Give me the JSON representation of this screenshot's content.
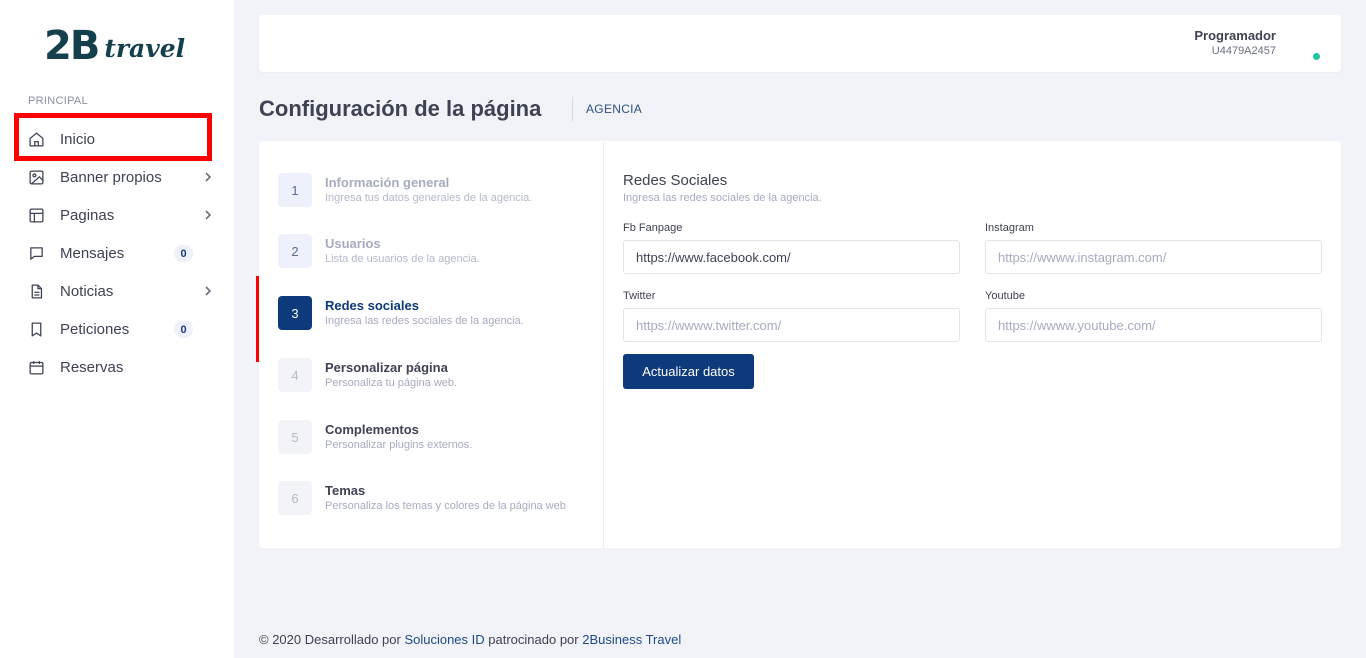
{
  "logo": {
    "main": "2B",
    "sub": "travel"
  },
  "sidebar": {
    "section_label": "PRINCIPAL",
    "items": [
      {
        "label": "Inicio",
        "icon": "home-icon"
      },
      {
        "label": "Banner propios",
        "icon": "image-icon",
        "chevron": true
      },
      {
        "label": "Paginas",
        "icon": "layout-icon",
        "chevron": true
      },
      {
        "label": "Mensajes",
        "icon": "message-icon",
        "badge": "0"
      },
      {
        "label": "Noticias",
        "icon": "document-icon",
        "chevron": true
      },
      {
        "label": "Peticiones",
        "icon": "bookmark-icon",
        "badge": "0"
      },
      {
        "label": "Reservas",
        "icon": "calendar-icon"
      }
    ]
  },
  "topbar": {
    "user_name": "Programador",
    "user_code": "U4479A2457",
    "status_color": "#1bc5a0"
  },
  "page": {
    "title": "Configuración de la página",
    "breadcrumb": "AGENCIA"
  },
  "steps": [
    {
      "number": "1",
      "title": "Información general",
      "desc": "Ingresa tus datos generales de la agencia.",
      "state": "done"
    },
    {
      "number": "2",
      "title": "Usuarios",
      "desc": "Lista de usuarios de la agencia.",
      "state": "done"
    },
    {
      "number": "3",
      "title": "Redes sociales",
      "desc": "Ingresa las redes sociales de la agencia.",
      "state": "active"
    },
    {
      "number": "4",
      "title": "Personalizar página",
      "desc": "Personaliza tu página web.",
      "state": "todo"
    },
    {
      "number": "5",
      "title": "Complementos",
      "desc": "Personalizar plugins externos.",
      "state": "todo"
    },
    {
      "number": "6",
      "title": "Temas",
      "desc": "Personaliza los temas y colores de la página web",
      "state": "todo"
    }
  ],
  "form": {
    "title": "Redes Sociales",
    "subtitle": "Ingresa las redes sociales de la agencia.",
    "fb_label": "Fb Fanpage",
    "fb_value": "https://www.facebook.com/",
    "instagram_label": "Instagram",
    "instagram_placeholder": "https://wwww.instagram.com/",
    "twitter_label": "Twitter",
    "twitter_placeholder": "https://wwww.twitter.com/",
    "youtube_label": "Youtube",
    "youtube_placeholder": "https://wwww.youtube.com/",
    "submit_label": "Actualizar datos"
  },
  "footer": {
    "prefix": "© 2020 Desarrollado por ",
    "link1": "Soluciones ID",
    "middle": " patrocinado por ",
    "link2": "2Business Travel"
  },
  "colors": {
    "accent": "#0c3a7a",
    "highlight": "#ff0000"
  }
}
